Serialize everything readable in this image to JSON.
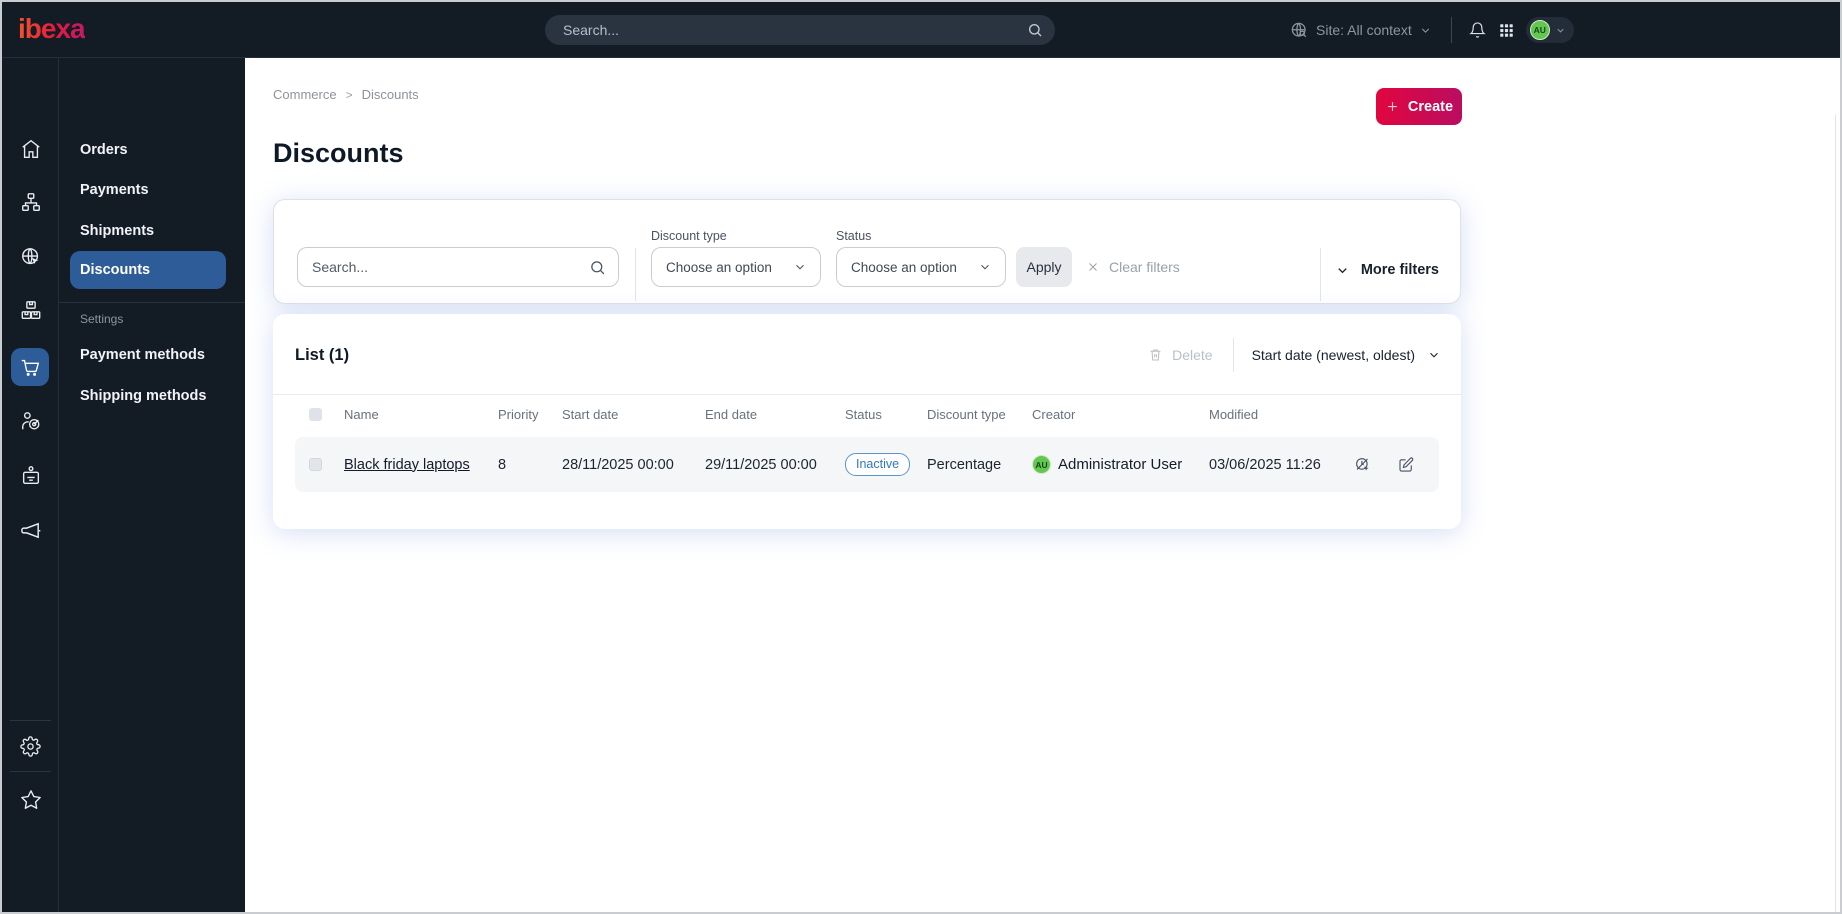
{
  "topbar": {
    "logo": "ibexa",
    "search_placeholder": "Search...",
    "site_context": "Site: All context",
    "avatar_initials": "AU"
  },
  "rail_icons": [
    "home-icon",
    "content-tree-icon",
    "site-globe-icon",
    "products-boxes-icon",
    "commerce-cart-icon",
    "target-audience-icon",
    "id-badge-icon",
    "megaphone-icon",
    "gear-icon",
    "star-icon"
  ],
  "menu": {
    "items": [
      "Orders",
      "Payments",
      "Shipments",
      "Discounts"
    ],
    "active_item": "Discounts",
    "section_label": "Settings",
    "settings_items": [
      "Payment methods",
      "Shipping methods"
    ]
  },
  "breadcrumb": {
    "items": [
      "Commerce",
      "Discounts"
    ],
    "separator": ">"
  },
  "page": {
    "title": "Discounts",
    "create_label": "Create"
  },
  "filters": {
    "search_placeholder": "Search...",
    "discount_type_label": "Discount type",
    "discount_type_value": "Choose an option",
    "status_label": "Status",
    "status_value": "Choose an option",
    "apply_label": "Apply",
    "clear_label": "Clear filters",
    "more_label": "More filters"
  },
  "list": {
    "title": "List (1)",
    "delete_label": "Delete",
    "sort_label": "Start date (newest, oldest)",
    "columns": [
      "Name",
      "Priority",
      "Start date",
      "End date",
      "Status",
      "Discount type",
      "Creator",
      "Modified"
    ],
    "rows": [
      {
        "name": "Black friday laptops",
        "priority": "8",
        "start_date": "28/11/2025 00:00",
        "end_date": "29/11/2025 00:00",
        "status": "Inactive",
        "discount_type": "Percentage",
        "creator": "Administrator User",
        "creator_initials": "AU",
        "modified": "03/06/2025 11:26"
      }
    ]
  },
  "colors": {
    "topbar_bg": "#131b25",
    "accent_blue": "#2d5c99",
    "brand_gradient_start": "#e1063f",
    "brand_gradient_end": "#ba0d61",
    "badge_blue": "#3377bb",
    "avatar_green": "#63c74f"
  }
}
